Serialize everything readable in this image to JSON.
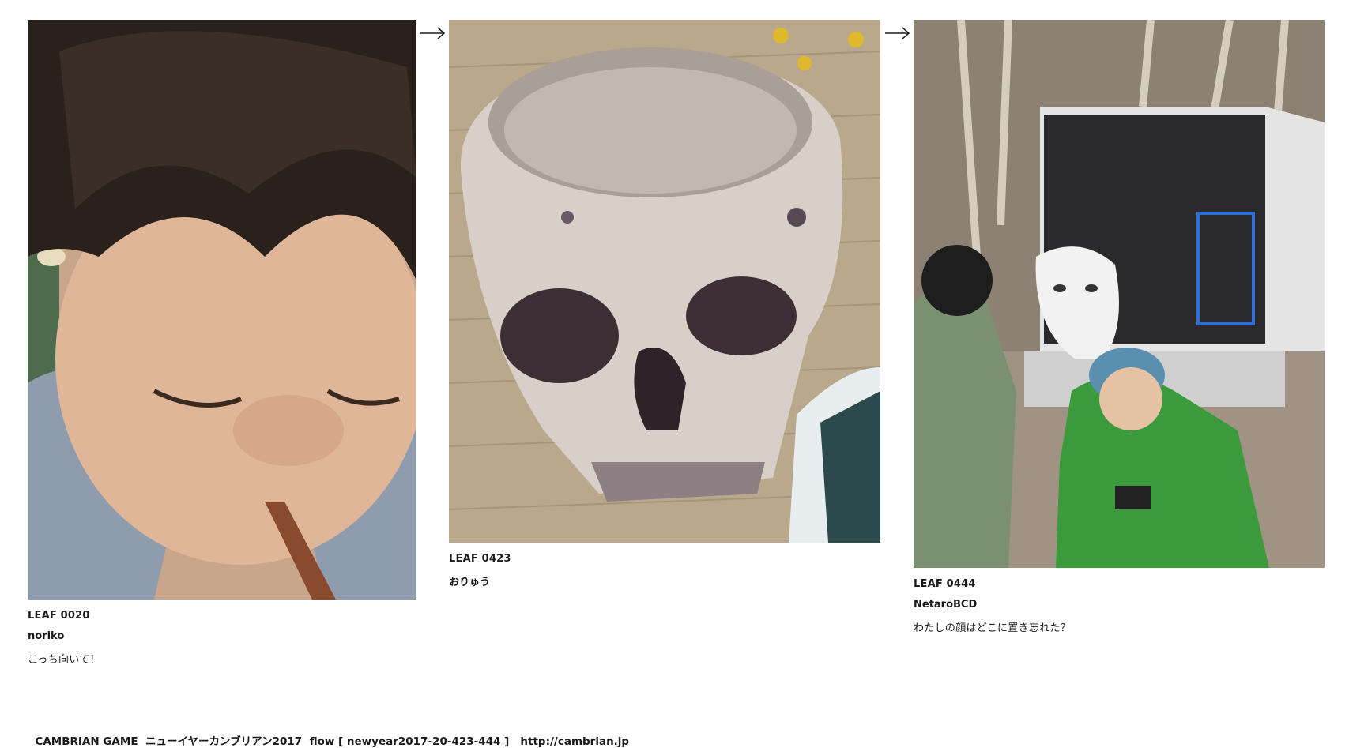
{
  "leaves": [
    {
      "id": "LEAF 0020",
      "author": "noriko",
      "comment": "こっち向いて！",
      "photo": "toddler-photo"
    },
    {
      "id": "LEAF 0423",
      "author": "おりゅう",
      "photo": "ceramic-skull-cup-photo"
    },
    {
      "id": "LEAF 0444",
      "author": "NetaroBCD",
      "comment": "わたしの顔はどこに置き忘れた？",
      "photo": "park-mask-truck-photo"
    }
  ],
  "arrows": [
    "arrow-right-icon",
    "arrow-right-icon"
  ],
  "footer": {
    "site": "CAMBRIAN GAME",
    "event": "ニューイヤーカンブリアン2017",
    "flow": "flow [ newyear2017-20-423-444 ]",
    "url": "http://cambrian.jp"
  },
  "colors": {
    "text": "#1a1a1a",
    "background": "#ffffff"
  }
}
